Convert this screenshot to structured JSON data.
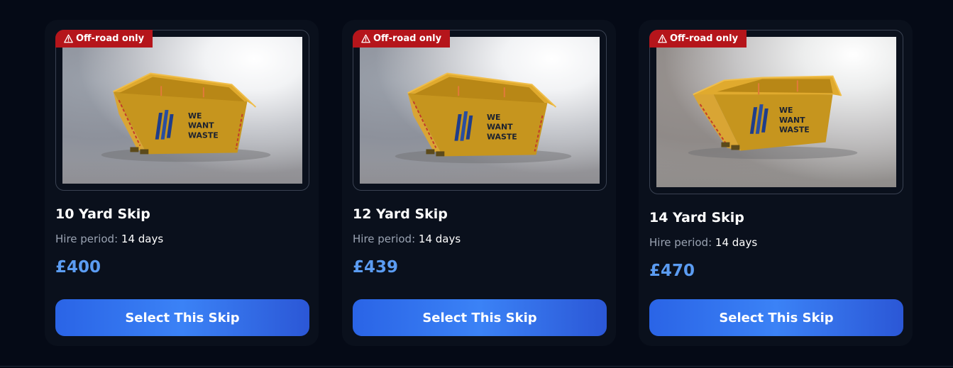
{
  "cards": [
    {
      "badge": "Off-road only",
      "title": "10 Yard Skip",
      "hire_label": "Hire period:",
      "hire_value": "14 days",
      "price": "£400",
      "button": "Select This Skip",
      "logo_text": [
        "WE",
        "WANT",
        "WASTE"
      ]
    },
    {
      "badge": "Off-road only",
      "title": "12 Yard Skip",
      "hire_label": "Hire period:",
      "hire_value": "14 days",
      "price": "£439",
      "button": "Select This Skip",
      "logo_text": [
        "WE",
        "WANT",
        "WASTE"
      ]
    },
    {
      "badge": "Off-road only",
      "title": "14 Yard Skip",
      "hire_label": "Hire period:",
      "hire_value": "14 days",
      "price": "£470",
      "button": "Select This Skip",
      "logo_text": [
        "WE",
        "WANT",
        "WASTE"
      ]
    }
  ],
  "colors": {
    "background": "#050a16",
    "card": "#0a101c",
    "badge": "#b5151b",
    "price": "#5b9cf2",
    "button": "#3b82f6",
    "skip_yellow": "#d4a31d"
  },
  "icons": {
    "badge": "warning-triangle-icon"
  }
}
